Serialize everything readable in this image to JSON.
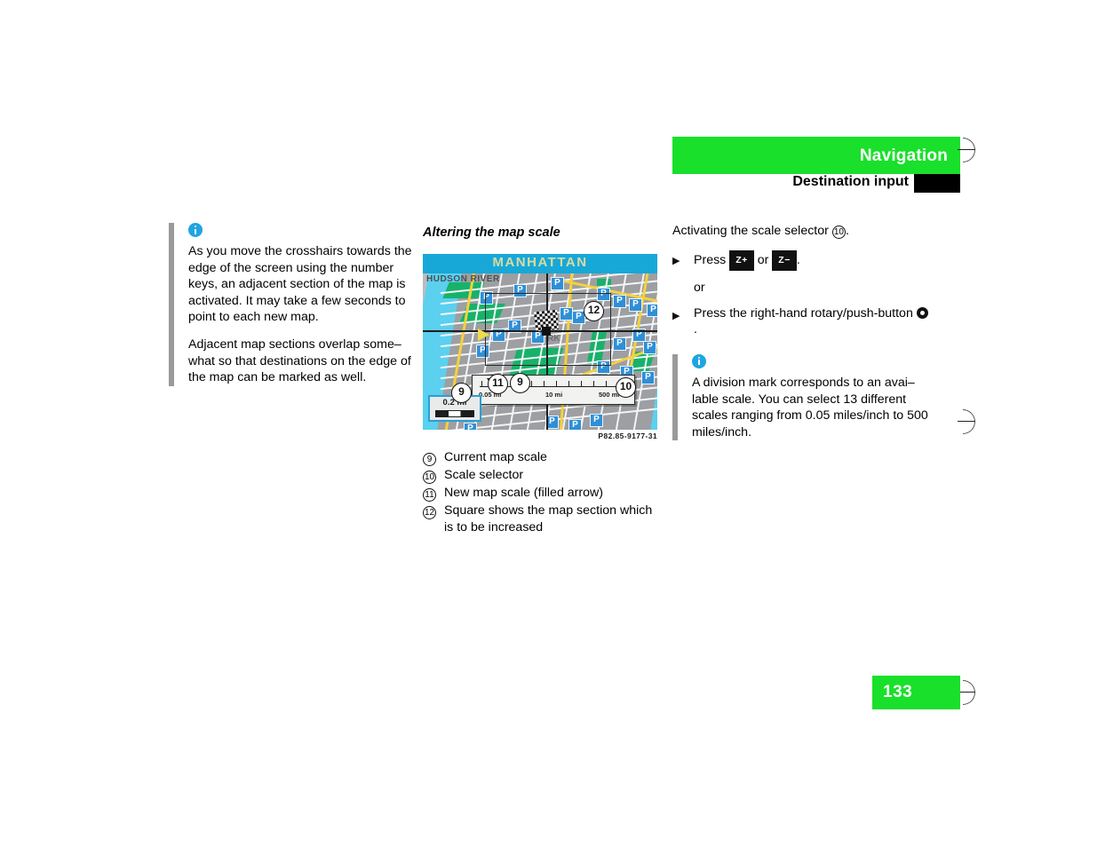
{
  "header": {
    "title": "Navigation",
    "subtitle": "Destination input",
    "bar_color": "#19E02A"
  },
  "left_column": {
    "note": {
      "icon": "info-icon",
      "paragraphs": [
        "As you move the crosshairs towards the edge of the screen using the number keys, an adjacent section of the map is activated. It may take a few seconds to point to each new map.",
        "Adjacent map sections overlap some–what so that destinations on the edge of the map can be marked as well."
      ]
    }
  },
  "middle_column": {
    "heading": "Altering the map scale",
    "figure": {
      "image_code": "P82.85-9177-31",
      "map_title": "MANHATTAN",
      "river_label": "HUDSON RIVER",
      "park_label": "RK",
      "parking_icon_label": "P",
      "current_scale": "0.2 mi",
      "scale_selector": {
        "tick_labels": [
          "0.05 mi",
          "10 mi",
          "500 mi"
        ]
      },
      "callouts": [
        "9",
        "11",
        "9",
        "12",
        "10"
      ]
    },
    "caption_list": [
      {
        "num": "9",
        "text": "Current map scale"
      },
      {
        "num": "10",
        "text": "Scale selector"
      },
      {
        "num": "11",
        "text": "New map scale (filled arrow)"
      },
      {
        "num": "12",
        "text": "Square shows the map section which is to be increased"
      }
    ]
  },
  "right_column": {
    "intro_prefix": "Activating the scale selector",
    "intro_ref": "10",
    "intro_suffix": ".",
    "step1_prefix": "Press",
    "key_zoom_in": "Z+",
    "step1_or": "or",
    "key_zoom_out": "Z−",
    "step1_suffix": ".",
    "or_label": "or",
    "step2_text": "Press the right-hand rotary/push-button",
    "step2_suffix": ".",
    "bullet_glyph": "▶",
    "note": {
      "icon": "info-icon",
      "text": "A division mark corresponds to an avai–lable scale. You can select 13 different scales ranging from 0.05 miles/inch to 500 miles/inch."
    }
  },
  "footer": {
    "page_number": "133"
  }
}
